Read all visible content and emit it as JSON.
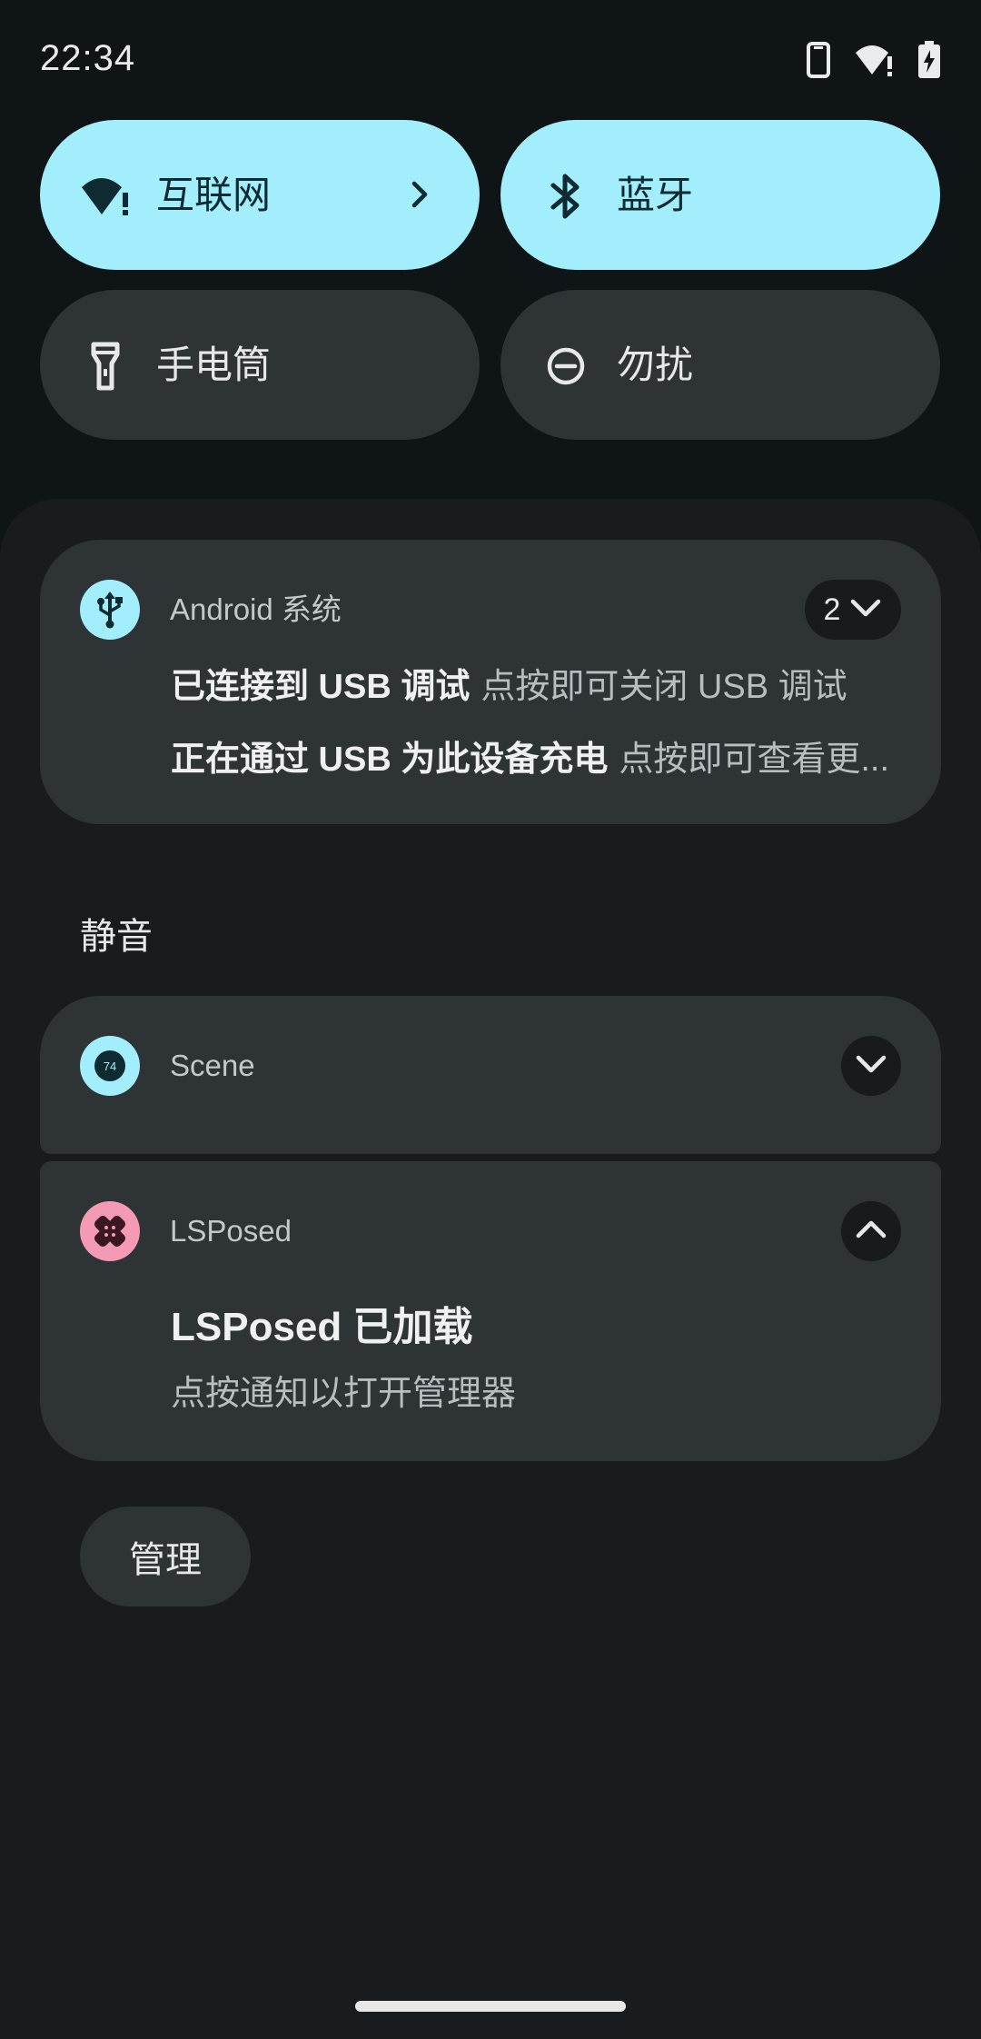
{
  "status_bar": {
    "time": "22:34",
    "icons": [
      "phone-icon",
      "wifi-alert-icon",
      "battery-charging-icon"
    ]
  },
  "quick_tiles": [
    {
      "label": "互联网",
      "icon": "wifi-alert-icon",
      "active": true,
      "has_chevron": true
    },
    {
      "label": "蓝牙",
      "icon": "bluetooth-icon",
      "active": true
    },
    {
      "label": "手电筒",
      "icon": "flashlight-icon",
      "active": false
    },
    {
      "label": "勿扰",
      "icon": "do-not-disturb-icon",
      "active": false
    }
  ],
  "notifications": {
    "android_system": {
      "app_name": "Android 系统",
      "icon": "usb-icon",
      "count": "2",
      "rows": [
        {
          "title": "已连接到 USB 调试",
          "text": "点按即可关闭 USB 调试"
        },
        {
          "title": "正在通过 USB 为此设备充电",
          "text": "点按即可查看更..."
        }
      ]
    },
    "silent_section": {
      "title": "静音"
    },
    "scene": {
      "app_name": "Scene",
      "icon": "scene-icon",
      "icon_text": "74"
    },
    "lsposed": {
      "app_name": "LSPosed",
      "icon": "lsposed-icon",
      "title": "LSPosed 已加载",
      "text": "点按通知以打开管理器"
    }
  },
  "manage_button": {
    "label": "管理"
  },
  "colors": {
    "background": "#0f1416",
    "shade": "#181c1e",
    "card": "#2e3336",
    "tile_active": "#a3eefd",
    "android_icon_bg": "#a3eefd",
    "lsposed_icon_bg": "#f49ab5"
  }
}
